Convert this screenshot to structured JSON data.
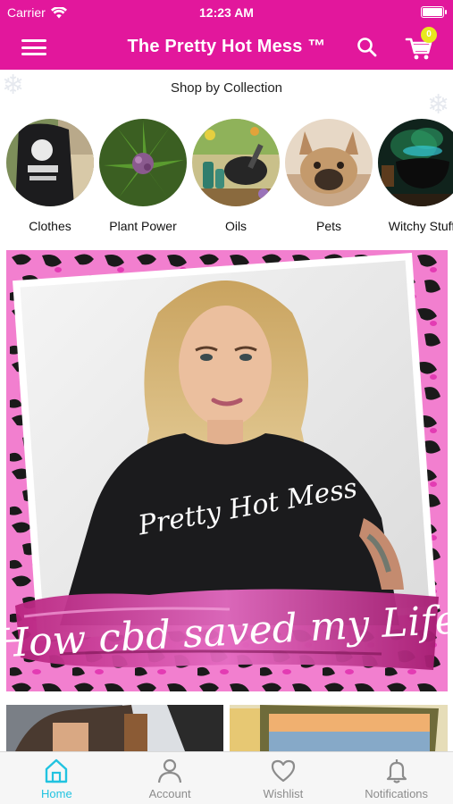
{
  "status_bar": {
    "carrier": "Carrier",
    "time": "12:23 AM"
  },
  "navbar": {
    "title": "The Pretty Hot Mess ™",
    "cart_count": "0",
    "brand_color": "#e2179c",
    "icons": {
      "menu": "hamburger-menu-icon",
      "search": "search-icon",
      "cart": "shopping-cart-icon"
    }
  },
  "collections": {
    "title": "Shop by Collection",
    "items": [
      {
        "label": "Clothes"
      },
      {
        "label": "Plant Power"
      },
      {
        "label": "Oils"
      },
      {
        "label": "Pets"
      },
      {
        "label": "Witchy Stuff"
      }
    ]
  },
  "hero": {
    "shirt_text": "Pretty Hot Mess",
    "headline": "How cbd saved my Life"
  },
  "tabbar": {
    "active_color": "#21c3e0",
    "tabs": [
      {
        "label": "Home",
        "icon": "home-icon",
        "active": true
      },
      {
        "label": "Account",
        "icon": "user-icon",
        "active": false
      },
      {
        "label": "Wishlist",
        "icon": "heart-icon",
        "active": false
      },
      {
        "label": "Notifications",
        "icon": "bell-icon",
        "active": false
      }
    ]
  }
}
